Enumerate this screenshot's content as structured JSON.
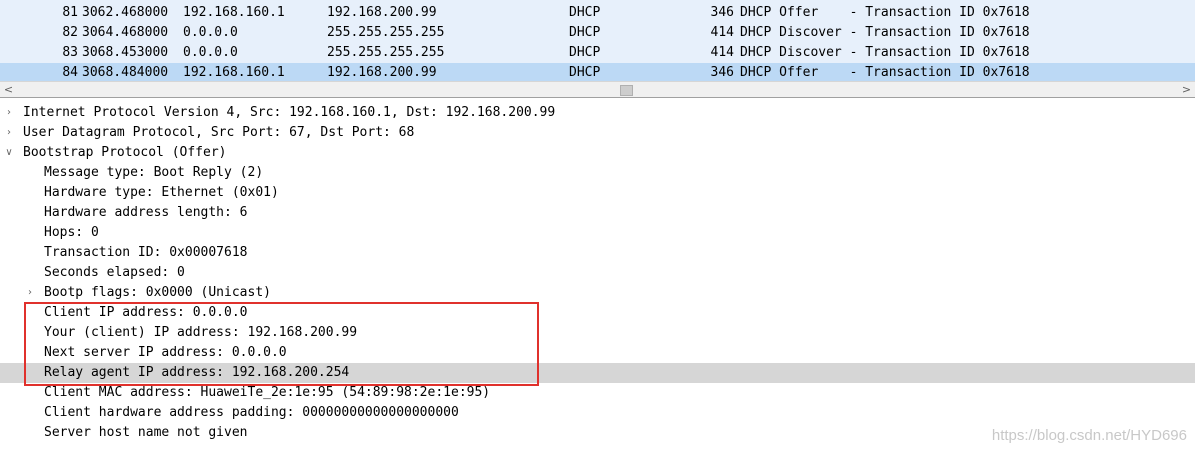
{
  "packet_list": {
    "rows": [
      {
        "no": "81",
        "time": "3062.468000",
        "src": "192.168.160.1",
        "dst": "192.168.200.99",
        "proto": "DHCP",
        "len": "346",
        "info": "DHCP Offer    - Transaction ID 0x7618",
        "selected": false
      },
      {
        "no": "82",
        "time": "3064.468000",
        "src": "0.0.0.0",
        "dst": "255.255.255.255",
        "proto": "DHCP",
        "len": "414",
        "info": "DHCP Discover - Transaction ID 0x7618",
        "selected": false
      },
      {
        "no": "83",
        "time": "3068.453000",
        "src": "0.0.0.0",
        "dst": "255.255.255.255",
        "proto": "DHCP",
        "len": "414",
        "info": "DHCP Discover - Transaction ID 0x7618",
        "selected": false
      },
      {
        "no": "84",
        "time": "3068.484000",
        "src": "192.168.160.1",
        "dst": "192.168.200.99",
        "proto": "DHCP",
        "len": "346",
        "info": "DHCP Offer    - Transaction ID 0x7618",
        "selected": true
      }
    ]
  },
  "scrollbar": {
    "left_arrow": "<",
    "right_arrow": ">"
  },
  "details": {
    "rows": [
      {
        "text": "Internet Protocol Version 4, Src: 192.168.160.1, Dst: 192.168.200.99",
        "level": 0,
        "toggle": "collapsed"
      },
      {
        "text": "User Datagram Protocol, Src Port: 67, Dst Port: 68",
        "level": 0,
        "toggle": "collapsed"
      },
      {
        "text": "Bootstrap Protocol (Offer)",
        "level": 0,
        "toggle": "expanded"
      },
      {
        "text": "Message type: Boot Reply (2)",
        "level": 1,
        "toggle": "none"
      },
      {
        "text": "Hardware type: Ethernet (0x01)",
        "level": 1,
        "toggle": "none"
      },
      {
        "text": "Hardware address length: 6",
        "level": 1,
        "toggle": "none"
      },
      {
        "text": "Hops: 0",
        "level": 1,
        "toggle": "none"
      },
      {
        "text": "Transaction ID: 0x00007618",
        "level": 1,
        "toggle": "none"
      },
      {
        "text": "Seconds elapsed: 0",
        "level": 1,
        "toggle": "none"
      },
      {
        "text": "Bootp flags: 0x0000 (Unicast)",
        "level": 1,
        "toggle": "collapsed"
      },
      {
        "text": "Client IP address: 0.0.0.0",
        "level": 1,
        "toggle": "none"
      },
      {
        "text": "Your (client) IP address: 192.168.200.99",
        "level": 1,
        "toggle": "none"
      },
      {
        "text": "Next server IP address: 0.0.0.0",
        "level": 1,
        "toggle": "none"
      },
      {
        "text": "Relay agent IP address: 192.168.200.254",
        "level": 1,
        "toggle": "none",
        "highlighted": true
      },
      {
        "text": "Client MAC address: HuaweiTe_2e:1e:95 (54:89:98:2e:1e:95)",
        "level": 1,
        "toggle": "none"
      },
      {
        "text": "Client hardware address padding: 00000000000000000000",
        "level": 1,
        "toggle": "none"
      },
      {
        "text": "Server host name not given",
        "level": 1,
        "toggle": "none"
      }
    ]
  },
  "watermark": "https://blog.csdn.net/HYD696",
  "colors": {
    "packet_bg": "#e7f0fb",
    "selected_bg": "#bcd9f5",
    "highlight_bg": "#d6d6d6",
    "annotation_box": "#e0312c"
  }
}
